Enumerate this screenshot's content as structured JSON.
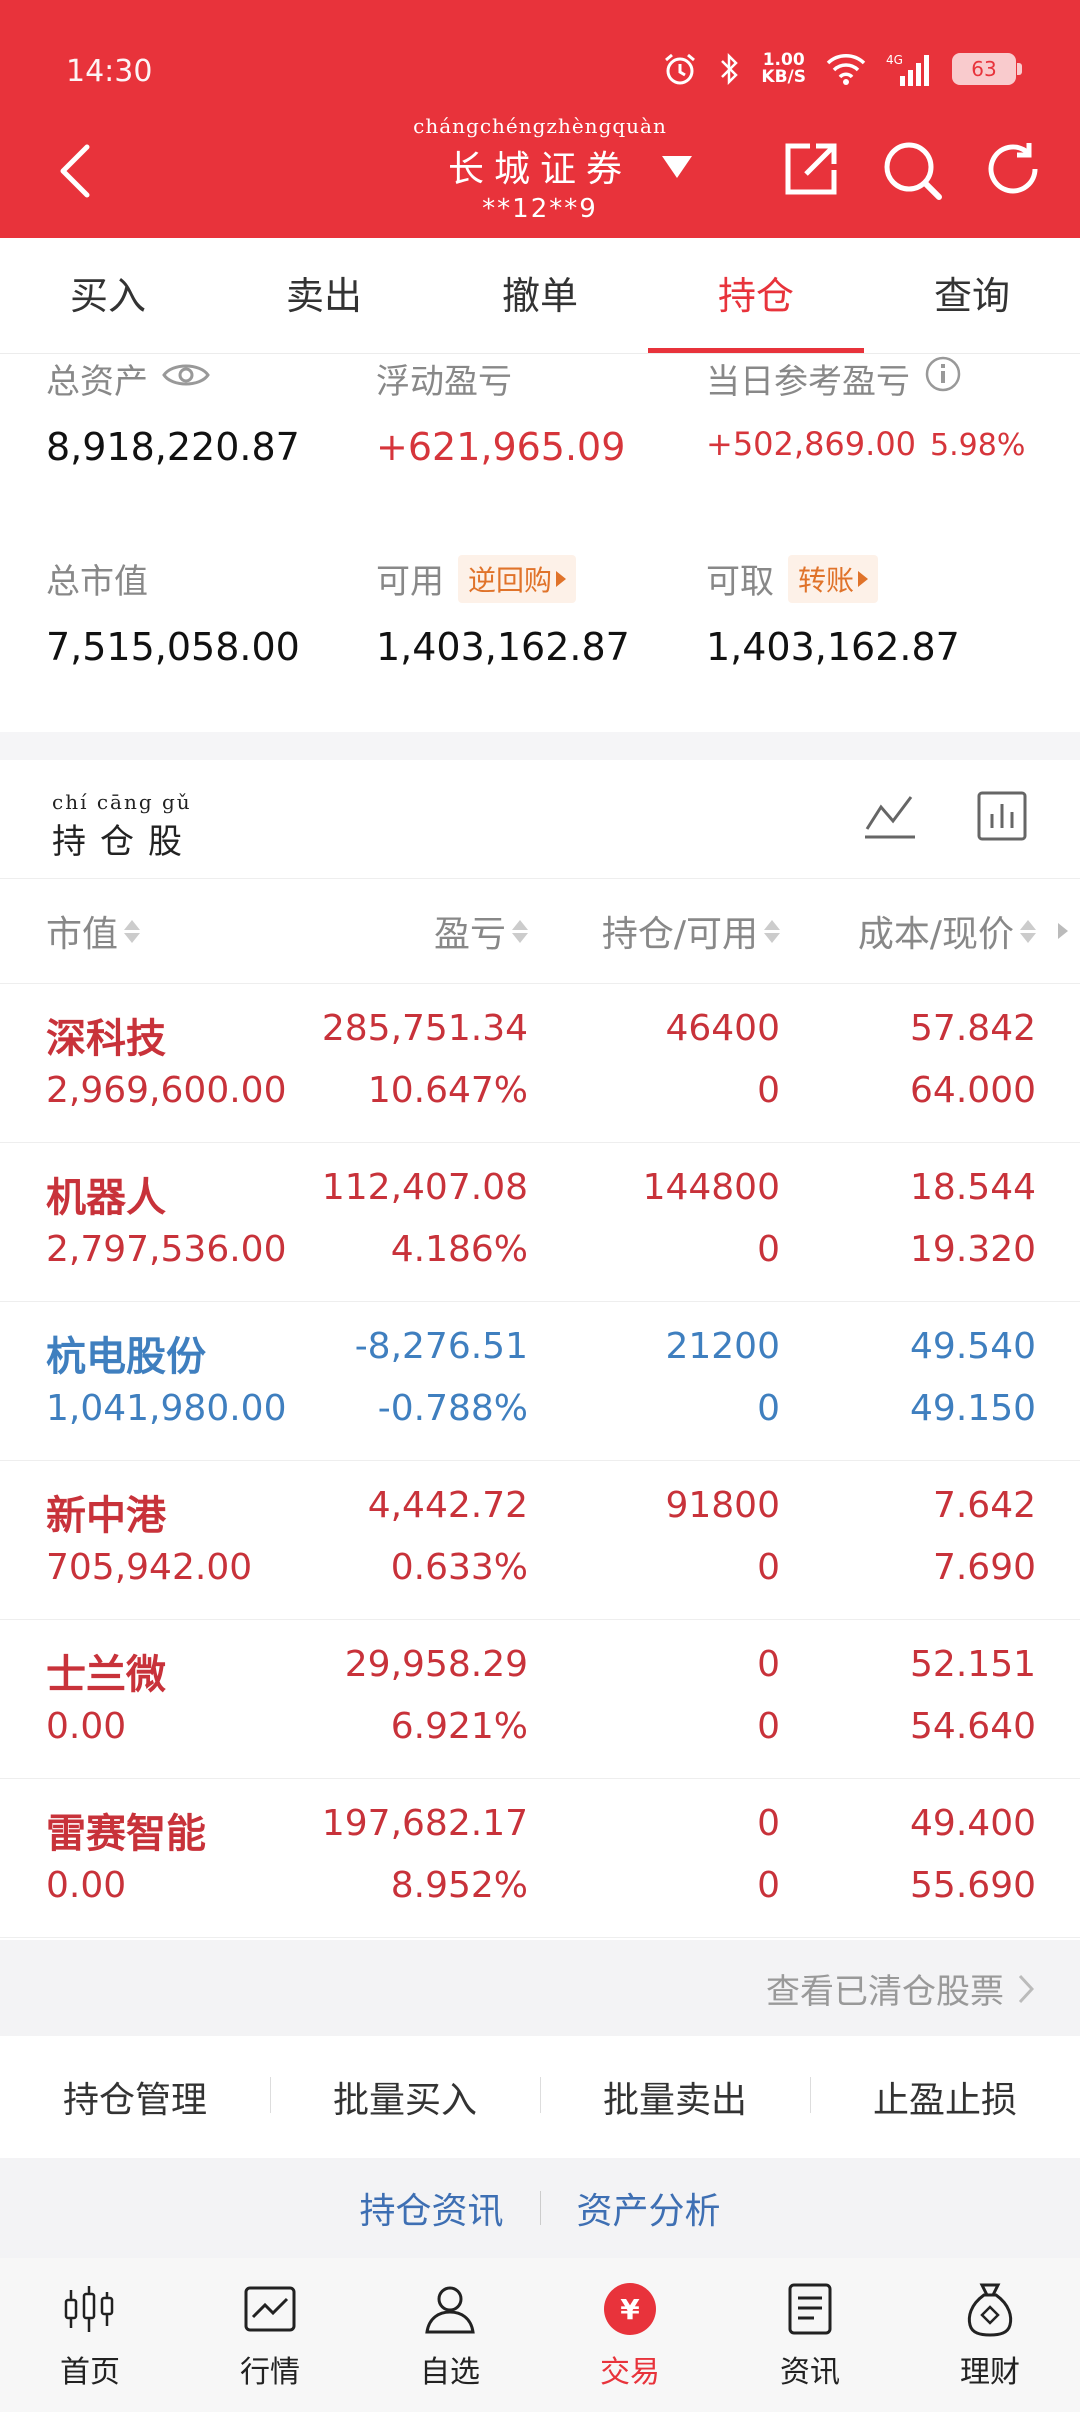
{
  "status_bar": {
    "time": "14:30",
    "net_speed_value": "1.00",
    "net_speed_unit": "KB/S",
    "network": "4G",
    "battery": "63"
  },
  "header": {
    "broker_pinyin": "chángchéngzhèngquàn",
    "broker_name": "长城证券",
    "account": "**12**9"
  },
  "tabs": [
    "买入",
    "卖出",
    "撤单",
    "持仓",
    "查询"
  ],
  "active_tab": "持仓",
  "assets": {
    "total_assets_label": "总资产",
    "total_assets": "8,918,220.87",
    "floating_pl_label": "浮动盈亏",
    "floating_pl": "+621,965.09",
    "daily_pl_label": "当日参考盈亏",
    "daily_pl": "+502,869.00",
    "daily_pl_pct": "5.98%",
    "market_value_label": "总市值",
    "market_value": "7,515,058.00",
    "available_label": "可用",
    "available_tag": "逆回购",
    "available": "1,403,162.87",
    "withdrawable_label": "可取",
    "withdrawable_tag": "转账",
    "withdrawable": "1,403,162.87"
  },
  "holdings": {
    "title_pinyin": "chí cāng gǔ",
    "title": "持仓股",
    "columns": [
      "市值",
      "盈亏",
      "持仓/可用",
      "成本/现价"
    ],
    "rows": [
      {
        "name": "深科技",
        "market_value": "2,969,600.00",
        "pl": "285,751.34",
        "pl_pct": "10.647%",
        "holding": "46400",
        "available": "0",
        "cost": "57.842",
        "price": "64.000",
        "trend": "up"
      },
      {
        "name": "机器人",
        "market_value": "2,797,536.00",
        "pl": "112,407.08",
        "pl_pct": "4.186%",
        "holding": "144800",
        "available": "0",
        "cost": "18.544",
        "price": "19.320",
        "trend": "up"
      },
      {
        "name": "杭电股份",
        "market_value": "1,041,980.00",
        "pl": "-8,276.51",
        "pl_pct": "-0.788%",
        "holding": "21200",
        "available": "0",
        "cost": "49.540",
        "price": "49.150",
        "trend": "down"
      },
      {
        "name": "新中港",
        "market_value": "705,942.00",
        "pl": "4,442.72",
        "pl_pct": "0.633%",
        "holding": "91800",
        "available": "0",
        "cost": "7.642",
        "price": "7.690",
        "trend": "up"
      },
      {
        "name": "士兰微",
        "market_value": "0.00",
        "pl": "29,958.29",
        "pl_pct": "6.921%",
        "holding": "0",
        "available": "0",
        "cost": "52.151",
        "price": "54.640",
        "trend": "up"
      },
      {
        "name": "雷赛智能",
        "market_value": "0.00",
        "pl": "197,682.17",
        "pl_pct": "8.952%",
        "holding": "0",
        "available": "0",
        "cost": "49.400",
        "price": "55.690",
        "trend": "up"
      }
    ],
    "cleared_link": "查看已清仓股票"
  },
  "actions": [
    "持仓管理",
    "批量买入",
    "批量卖出",
    "止盈止损"
  ],
  "links": [
    "持仓资讯",
    "资产分析"
  ],
  "bottom_nav": [
    {
      "label": "首页",
      "icon": "candlestick-icon"
    },
    {
      "label": "行情",
      "icon": "market-chart-icon"
    },
    {
      "label": "自选",
      "icon": "user-star-icon"
    },
    {
      "label": "交易",
      "icon": "yuan-icon"
    },
    {
      "label": "资讯",
      "icon": "document-icon"
    },
    {
      "label": "理财",
      "icon": "money-bag-icon"
    }
  ],
  "bottom_nav_active": "交易",
  "colors": {
    "brand_red": "#e8333b",
    "gain_red": "#c8323a",
    "loss_blue": "#3f7fbf",
    "tag_orange": "#e0732a"
  }
}
